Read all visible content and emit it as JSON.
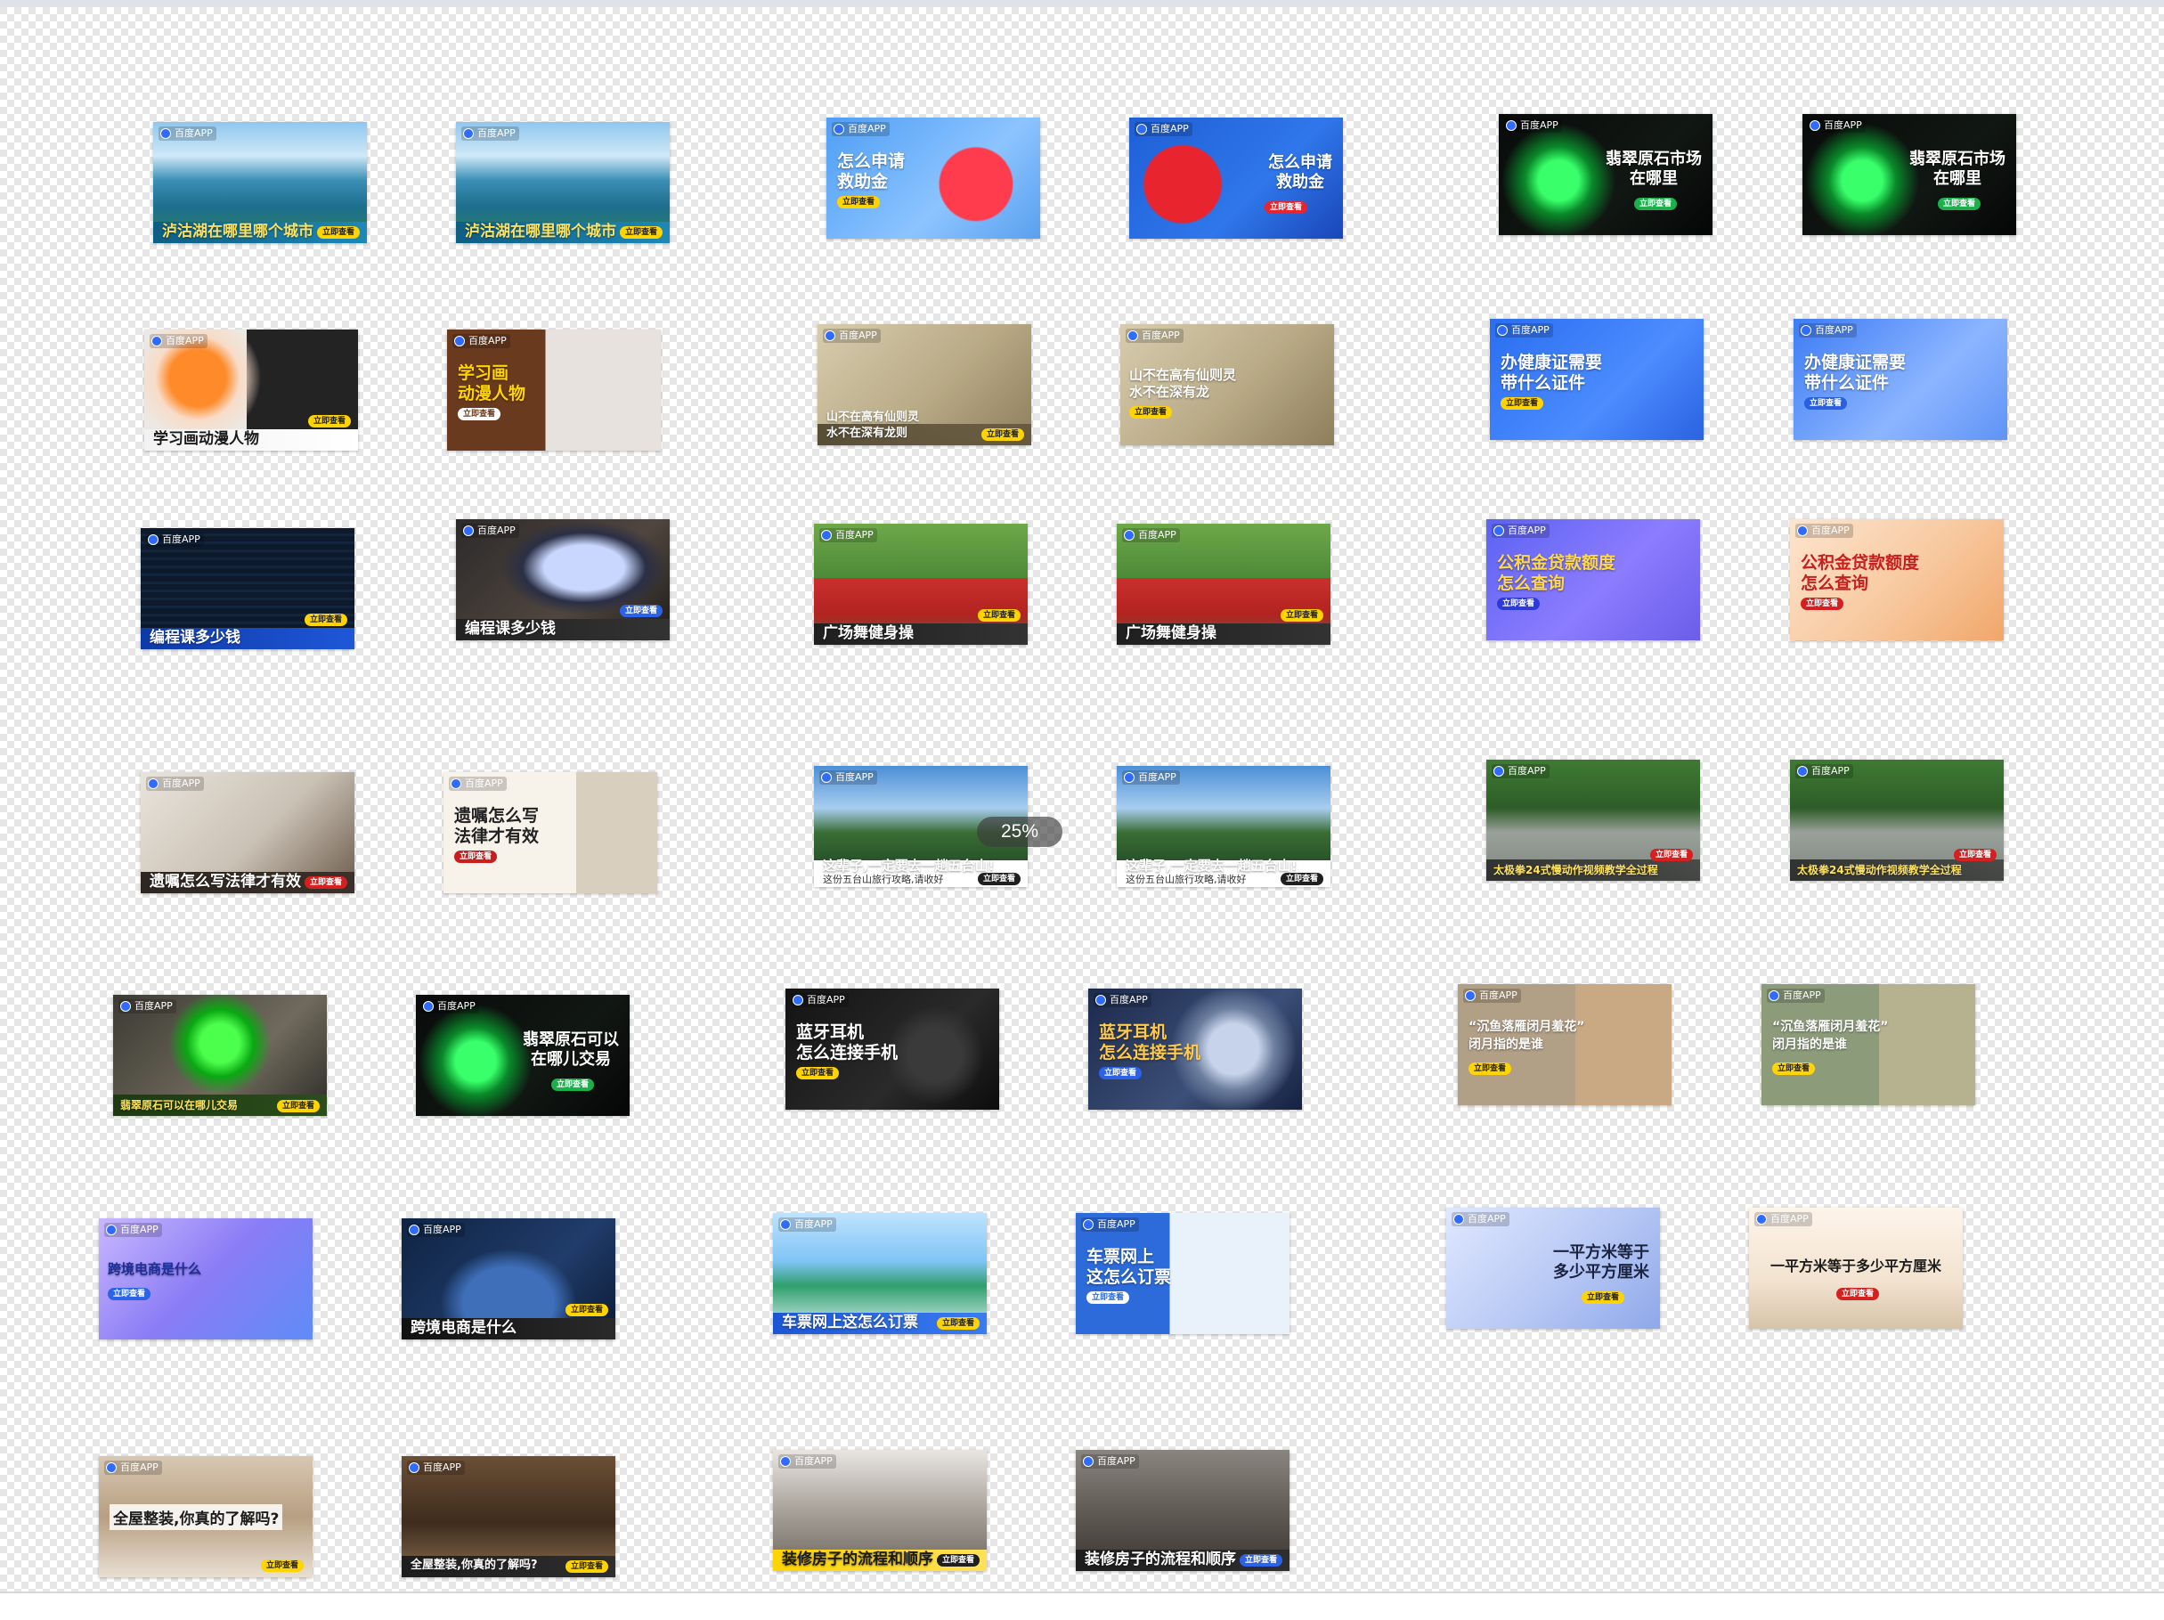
{
  "brand_label": "百度APP",
  "default_cta": "立即查看",
  "progress_label": "25%",
  "cards": [
    {
      "title": "泸沽湖在哪里哪个城市",
      "cta": "立即查看",
      "theme": "lake",
      "layout": "bottom"
    },
    {
      "title": "泸沽湖在哪里哪个城市",
      "cta": "立即查看",
      "theme": "lake",
      "layout": "bottom"
    },
    {
      "title": "怎么申请\n救助金",
      "cta": "立即查看",
      "theme": "heart-blue",
      "layout": "left"
    },
    {
      "title": "怎么申请\n救助金",
      "cta": "立即查看",
      "theme": "heart-navy",
      "layout": "right"
    },
    {
      "title": "翡翠原石市场\n在哪里",
      "cta": "立即查看",
      "theme": "jade-dark",
      "layout": "right"
    },
    {
      "title": "翡翠原石市场\n在哪里",
      "cta": "立即查看",
      "theme": "jade-dark",
      "layout": "right"
    },
    {
      "title": "学习画动漫人物",
      "cta": "立即查看",
      "theme": "anime-dark",
      "layout": "bottom-light"
    },
    {
      "title": "学习画\n动漫人物",
      "cta": "立即查看",
      "theme": "anime-brown",
      "layout": "left"
    },
    {
      "title": "山不在高有仙则灵\n水不在深有龙则",
      "cta": "立即查看",
      "theme": "ink",
      "layout": "bottom"
    },
    {
      "title": "山不在高有仙则灵\n水不在深有龙",
      "cta": "立即查看",
      "theme": "ink",
      "layout": "left-mid"
    },
    {
      "title": "办健康证需要\n带什么证件",
      "cta": "立即查看",
      "theme": "blue-office",
      "layout": "left"
    },
    {
      "title": "办健康证需要\n带什么证件",
      "cta": "立即查看",
      "theme": "blue-light",
      "layout": "left"
    },
    {
      "title": "编程课多少钱",
      "cta": "立即查看",
      "theme": "code",
      "layout": "bottom"
    },
    {
      "title": "编程课多少钱",
      "cta": "立即查看",
      "theme": "laptop",
      "layout": "bottom"
    },
    {
      "title": "广场舞健身操",
      "cta": "立即查看",
      "theme": "dance",
      "layout": "bottom"
    },
    {
      "title": "广场舞健身操",
      "cta": "立即查看",
      "theme": "dance",
      "layout": "bottom"
    },
    {
      "title": "公积金贷款额度\n怎么查询",
      "cta": "立即查看",
      "theme": "purple",
      "layout": "left"
    },
    {
      "title": "公积金贷款额度\n怎么查询",
      "cta": "立即查看",
      "theme": "peach",
      "layout": "left-dark"
    },
    {
      "title": "遗嘱怎么写法律才有效",
      "cta": "立即查看",
      "theme": "seal",
      "layout": "bottom"
    },
    {
      "title": "遗嘱怎么写\n法律才有效",
      "cta": "立即查看",
      "theme": "paper",
      "layout": "left-dark"
    },
    {
      "title": "这辈子,一定要去一趟五台山!",
      "sub": "这份五台山旅行攻略,请收好",
      "cta": "立即查看",
      "theme": "temple",
      "layout": "bottom-sub"
    },
    {
      "title": "这辈子,一定要去一趟五台山!",
      "sub": "这份五台山旅行攻略,请收好",
      "cta": "立即查看",
      "theme": "temple",
      "layout": "bottom-sub"
    },
    {
      "title": "太极拳24式慢动作视频教学全过程",
      "cta": "立即查看",
      "theme": "park",
      "layout": "bottom-small"
    },
    {
      "title": "太极拳24式慢动作视频教学全过程",
      "cta": "立即查看",
      "theme": "park",
      "layout": "bottom-small"
    },
    {
      "title": "翡翠原石可以在哪儿交易",
      "cta": "立即查看",
      "theme": "jade-green",
      "layout": "bottom-small"
    },
    {
      "title": "翡翠原石可以\n在哪儿交易",
      "cta": "立即查看",
      "theme": "jade-dark",
      "layout": "right"
    },
    {
      "title": "蓝牙耳机\n怎么连接手机",
      "cta": "立即查看",
      "theme": "earbuds",
      "layout": "left"
    },
    {
      "title": "蓝牙耳机\n怎么连接手机",
      "cta": "立即查看",
      "theme": "headphones",
      "layout": "left"
    },
    {
      "title": "“沉鱼落雁闭月羞花”\n闭月指的是谁",
      "cta": "立即查看",
      "theme": "beauty",
      "layout": "left"
    },
    {
      "title": "“沉鱼落雁闭月羞花”\n闭月指的是谁",
      "cta": "立即查看",
      "theme": "beauty-green",
      "layout": "left"
    },
    {
      "title": "跨境电商是什么",
      "cta": "立即查看",
      "theme": "violet",
      "layout": "left-mid"
    },
    {
      "title": "跨境电商是什么",
      "cta": "立即查看",
      "theme": "globe",
      "layout": "bottom"
    },
    {
      "title": "车票网上这怎么订票",
      "cta": "立即查看",
      "theme": "train-light",
      "layout": "bottom"
    },
    {
      "title": "车票网上\n这怎么订票",
      "cta": "立即查看",
      "theme": "train-blue",
      "layout": "left"
    },
    {
      "title": "一平方米等于\n多少平方厘米",
      "cta": "立即查看",
      "theme": "ruler",
      "layout": "right-dark"
    },
    {
      "title": "一平方米等于多少平方厘米",
      "cta": "立即查看",
      "theme": "desk",
      "layout": "center-dark"
    },
    {
      "title": "全屋整装,你真的了解吗?",
      "cta": "立即查看",
      "theme": "room",
      "layout": "mid-dark"
    },
    {
      "title": "全屋整装,你真的了解吗?",
      "cta": "立即查看",
      "theme": "room-dark",
      "layout": "bottom"
    },
    {
      "title": "装修房子的流程和顺序",
      "cta": "立即查看",
      "theme": "reno",
      "layout": "bottom"
    },
    {
      "title": "装修房子的流程和顺序",
      "cta": "立即查看",
      "theme": "reno-dark",
      "layout": "bottom"
    }
  ]
}
